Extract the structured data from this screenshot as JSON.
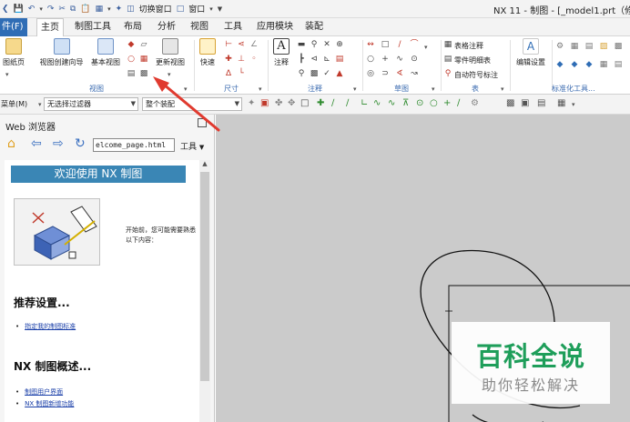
{
  "window": {
    "title": "NX 11 - 制图 - [_model1.prt（修改",
    "quick_access": [
      "切换窗口",
      "窗口"
    ]
  },
  "tabs": [
    {
      "label": "件(F)"
    },
    {
      "label": "主页"
    },
    {
      "label": "制图工具"
    },
    {
      "label": "布局"
    },
    {
      "label": "分析"
    },
    {
      "label": "视图"
    },
    {
      "label": "工具"
    },
    {
      "label": "应用模块"
    },
    {
      "label": "装配"
    }
  ],
  "ribbon": {
    "view_group": {
      "label": "视图",
      "new_sheet": "图纸页",
      "view_wizard": "视图创建向导",
      "base_view": "基本视图",
      "update_view": "更新视图"
    },
    "dimension_group": {
      "label": "尺寸",
      "quick": "快速"
    },
    "annotation_group": {
      "label": "注释",
      "note": "注释"
    },
    "sketch_group": {
      "label": "草图"
    },
    "table_group": {
      "label": "表",
      "table_note": "表格注释",
      "parts_list": "零件明细表",
      "auto_balloon": "自动符号标注"
    },
    "settings": {
      "edit_settings": "编辑设置"
    },
    "std_tools": {
      "label": "标准化工具..."
    }
  },
  "filterbar": {
    "menu": "菜单(M)",
    "filter": "无选择过滤器",
    "assembly": "整个装配"
  },
  "web_panel": {
    "title": "Web 浏览器",
    "url": "elcome_page.html",
    "tools": "工具",
    "welcome": "欢迎使用 NX 制图",
    "intro": "开始前，您可能需要熟悉以下内容：",
    "h_settings": "推荐设置...",
    "link_standard": "指定我的制图标准",
    "h_overview": "NX 制图概述...",
    "link_ui": "制图用户界面",
    "link_new": "NX 制图新增功能"
  },
  "watermark": {
    "title": "百科全说",
    "subtitle": "助你轻松解决"
  },
  "colors": {
    "file_tab": "#2f6db5",
    "welcome_banner": "#3a86b5",
    "group_label": "#3b6bb0",
    "drawing_bg": "#cbcbcb",
    "watermark_green": "#1e9e5a",
    "arrow_red": "#e03a2f"
  }
}
